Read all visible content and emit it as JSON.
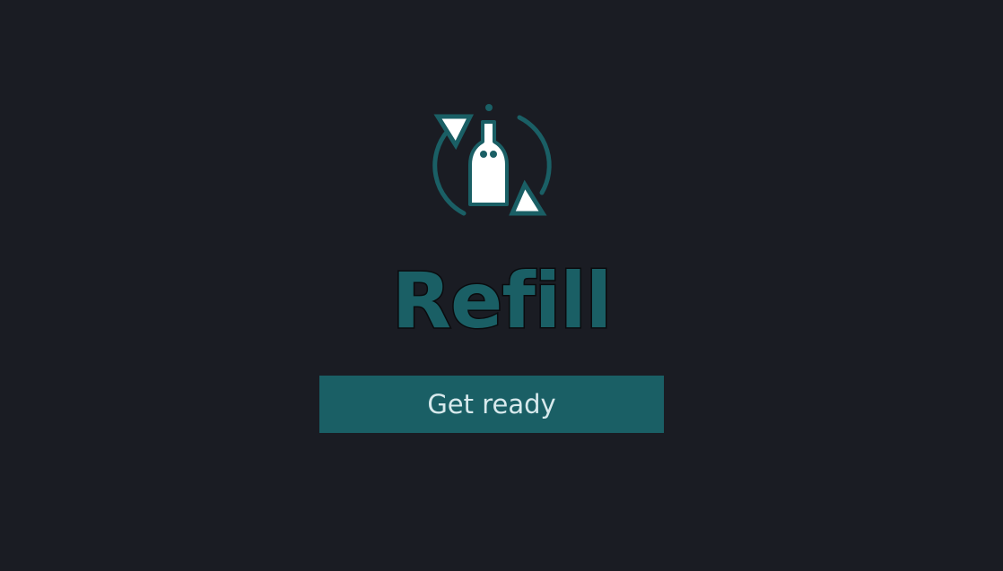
{
  "app": {
    "title": "Refill",
    "logo_icon": "refill-bottle-icon"
  },
  "actions": {
    "get_ready_label": "Get ready"
  },
  "colors": {
    "background": "#1a1c23",
    "accent": "#1a5f65",
    "button_text": "#d7e9ec",
    "icon_fill": "#ffffff"
  }
}
